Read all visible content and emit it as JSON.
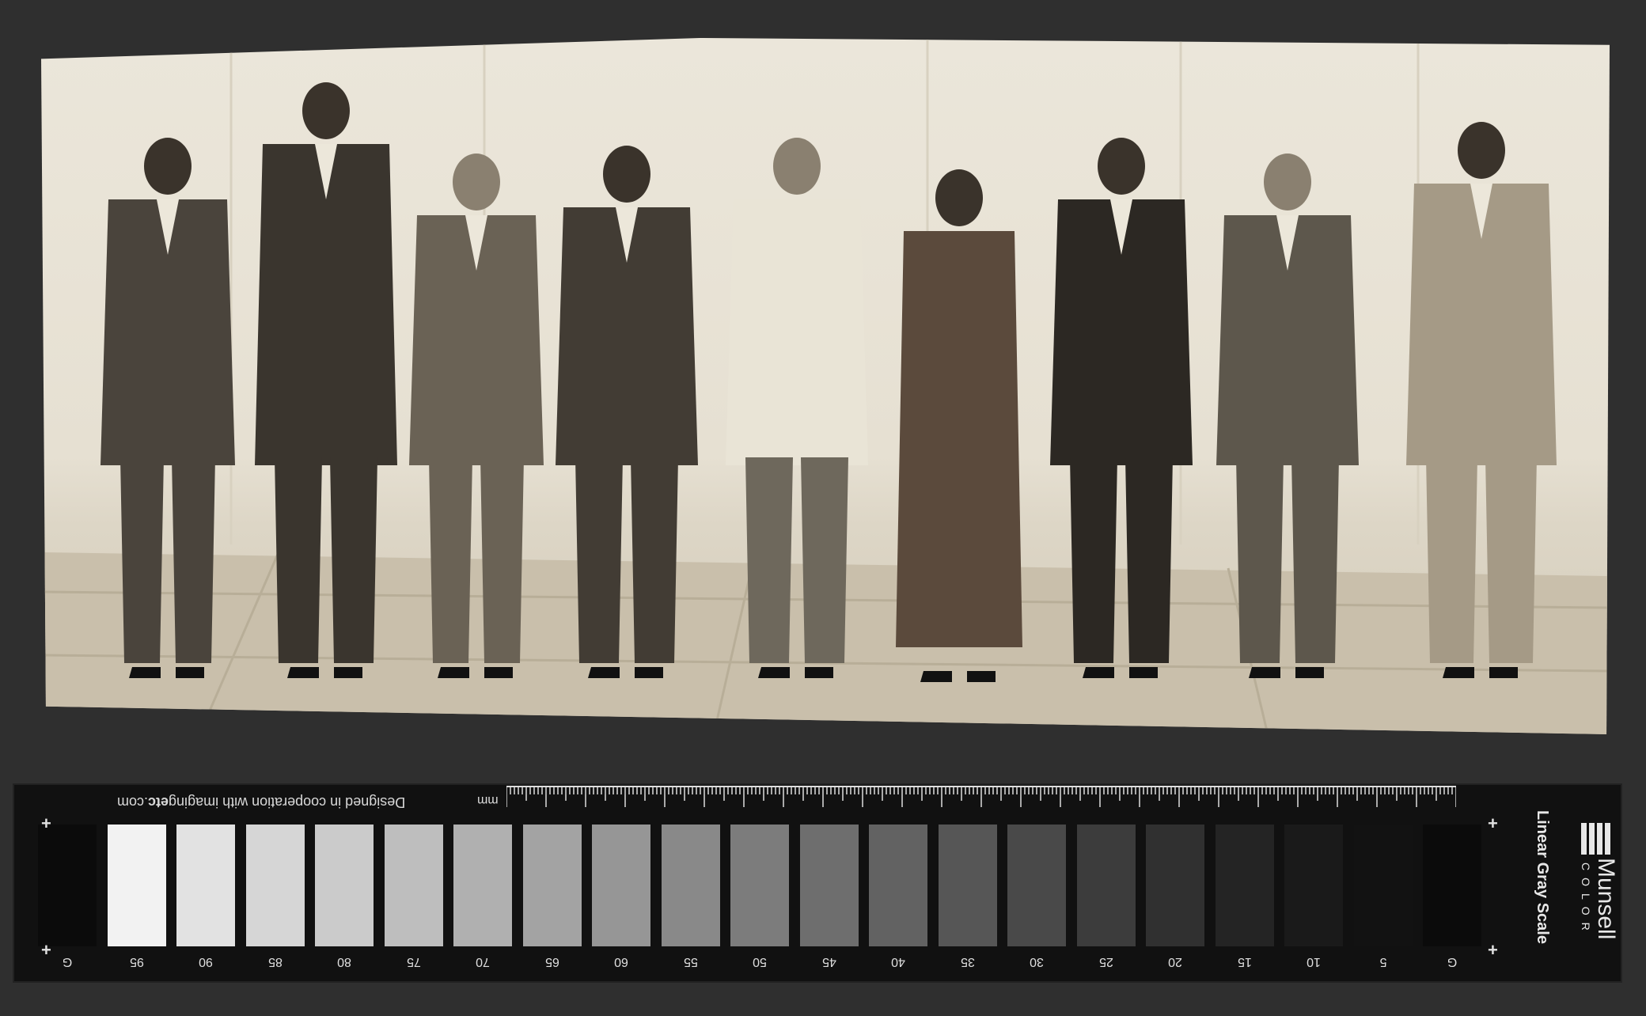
{
  "photo": {
    "subject": "group-of-nine-standing-figures"
  },
  "card": {
    "credit_prefix": "Designed in cooperation with imaging",
    "credit_bold": "etc",
    "credit_suffix": ".com",
    "unit": "mm",
    "brand": "Munsell",
    "brand_sub": "COLOR",
    "title": "Linear Gray Scale",
    "swatches": [
      {
        "label": "G",
        "color": "#0b0b0b"
      },
      {
        "label": "95",
        "color": "#f2f2f2"
      },
      {
        "label": "90",
        "color": "#e2e2e2"
      },
      {
        "label": "85",
        "color": "#d6d6d6"
      },
      {
        "label": "80",
        "color": "#cbcbcb"
      },
      {
        "label": "75",
        "color": "#bebebe"
      },
      {
        "label": "70",
        "color": "#b0b0b0"
      },
      {
        "label": "65",
        "color": "#a3a3a3"
      },
      {
        "label": "60",
        "color": "#969696"
      },
      {
        "label": "55",
        "color": "#898989"
      },
      {
        "label": "50",
        "color": "#7c7c7c"
      },
      {
        "label": "45",
        "color": "#6e6e6e"
      },
      {
        "label": "40",
        "color": "#626262"
      },
      {
        "label": "35",
        "color": "#565656"
      },
      {
        "label": "30",
        "color": "#494949"
      },
      {
        "label": "25",
        "color": "#3c3c3c"
      },
      {
        "label": "20",
        "color": "#303030"
      },
      {
        "label": "15",
        "color": "#242424"
      },
      {
        "label": "10",
        "color": "#1a1a1a"
      },
      {
        "label": "5",
        "color": "#121212"
      },
      {
        "label": "G",
        "color": "#0b0b0b"
      }
    ]
  }
}
